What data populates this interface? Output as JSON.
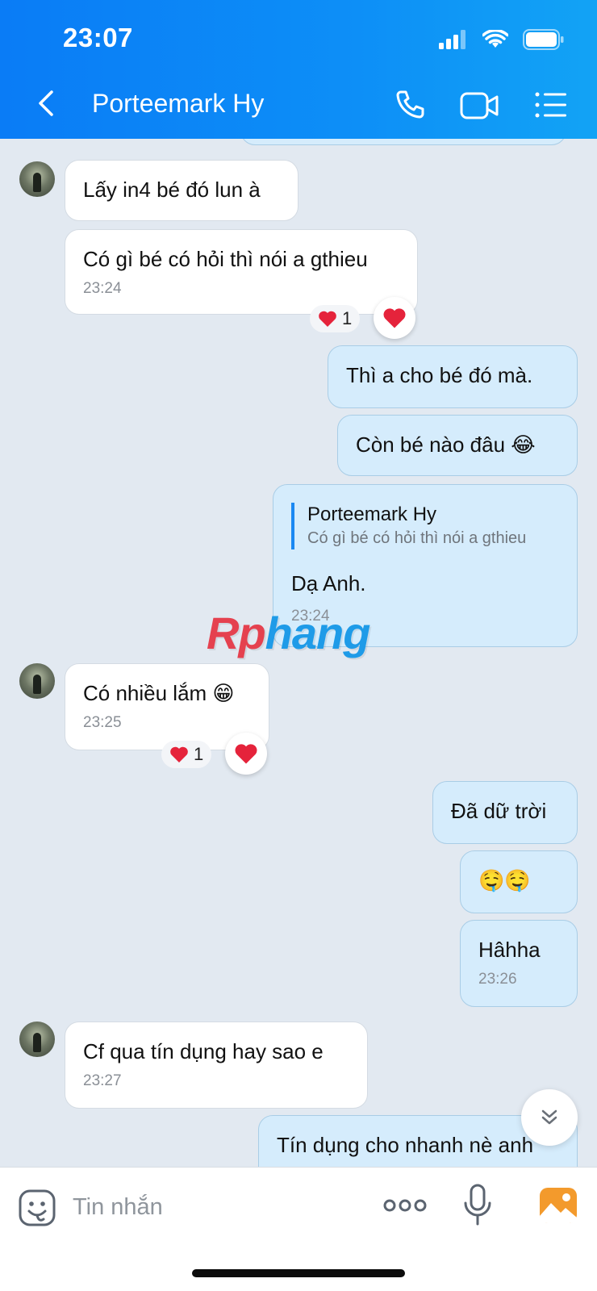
{
  "status_bar": {
    "time": "23:07"
  },
  "header": {
    "contact_name": "Porteemark Hy"
  },
  "messages": [
    {
      "side": "in",
      "text": "Lấy in4 bé đó lun à"
    },
    {
      "side": "in",
      "text": "Có gì bé có hỏi thì nói a gthieu",
      "time": "23:24",
      "reaction_count": "1"
    },
    {
      "side": "out",
      "text": "Thì a cho bé đó mà."
    },
    {
      "side": "out",
      "text": "Còn bé nào đâu 😂"
    },
    {
      "side": "out",
      "quote_name": "Porteemark Hy",
      "quote_text": "Có gì bé có hỏi thì nói a gthieu",
      "text": "Dạ Anh.",
      "time": "23:24"
    },
    {
      "side": "in",
      "text": "Có nhiều lắm 😁",
      "time": "23:25",
      "reaction_count": "1"
    },
    {
      "side": "out",
      "text": "Đã dữ trời"
    },
    {
      "side": "out",
      "text": "🤤🤤"
    },
    {
      "side": "out",
      "text": "Hâhha",
      "time": "23:26"
    },
    {
      "side": "in",
      "text": "Cf qua tín dụng hay sao e",
      "time": "23:27"
    },
    {
      "side": "out",
      "text": "Tín dụng cho nhanh nè anh"
    }
  ],
  "watermark": {
    "part1": "Rp",
    "part2": "hang"
  },
  "input": {
    "placeholder": "Tin nhắn"
  },
  "icons": [
    "back-icon",
    "phone-icon",
    "video-icon",
    "menu-icon",
    "sticker-icon",
    "more-icon",
    "mic-icon",
    "photo-icon",
    "chevron-down-icon",
    "heart-icon"
  ]
}
